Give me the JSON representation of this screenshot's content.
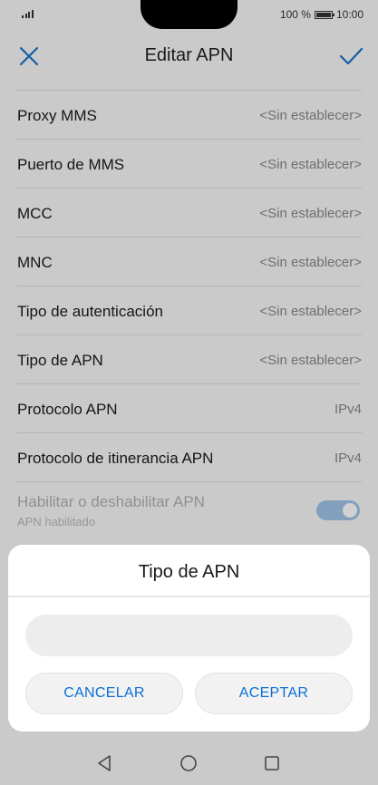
{
  "status_bar": {
    "battery_percent": "100 %",
    "time": "10:00"
  },
  "header": {
    "title": "Editar APN",
    "close_icon": "close-icon",
    "confirm_icon": "check-icon",
    "accent_color": "#1a73c8"
  },
  "settings": [
    {
      "label": "Proxy MMS",
      "value": "<Sin establecer>"
    },
    {
      "label": "Puerto de MMS",
      "value": "<Sin establecer>"
    },
    {
      "label": "MCC",
      "value": "<Sin establecer>"
    },
    {
      "label": "MNC",
      "value": "<Sin establecer>"
    },
    {
      "label": "Tipo de autenticación",
      "value": "<Sin establecer>"
    },
    {
      "label": "Tipo de APN",
      "value": "<Sin establecer>"
    },
    {
      "label": "Protocolo APN",
      "value": "IPv4"
    },
    {
      "label": "Protocolo de itinerancia APN",
      "value": "IPv4"
    }
  ],
  "apn_toggle": {
    "label": "Habilitar o deshabilitar APN",
    "sublabel": "APN habilitado",
    "on": true
  },
  "dialog": {
    "title": "Tipo de APN",
    "input_value": "",
    "cancel_label": "CANCELAR",
    "accept_label": "ACEPTAR"
  },
  "nav_bar": {
    "back_icon": "back-triangle-icon",
    "home_icon": "home-circle-icon",
    "recent_icon": "recent-square-icon"
  }
}
